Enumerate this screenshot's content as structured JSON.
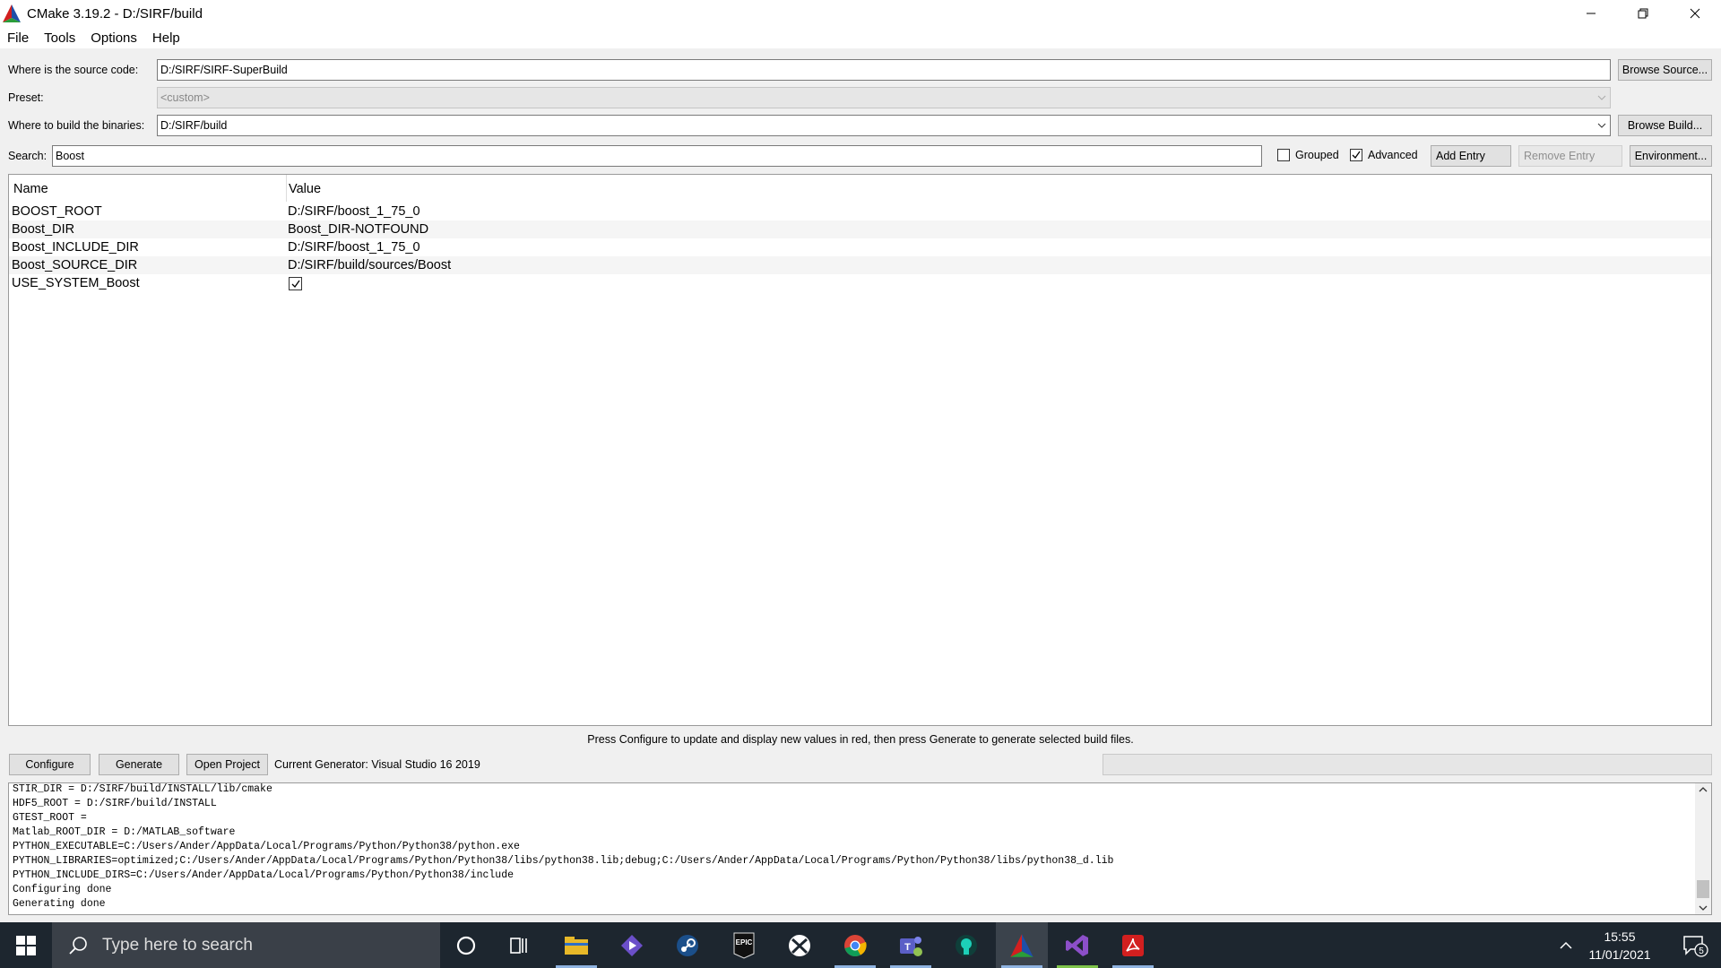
{
  "window": {
    "title": "CMake 3.19.2 - D:/SIRF/build"
  },
  "menu": [
    "File",
    "Tools",
    "Options",
    "Help"
  ],
  "source": {
    "label": "Where is the source code:",
    "value": "D:/SIRF/SIRF-SuperBuild",
    "browse": "Browse Source..."
  },
  "preset": {
    "label": "Preset:",
    "value": "<custom>"
  },
  "build": {
    "label": "Where to build the binaries:",
    "value": "D:/SIRF/build",
    "browse": "Browse Build..."
  },
  "search": {
    "label": "Search:",
    "value": "Boost"
  },
  "options": {
    "grouped": {
      "label": "Grouped",
      "checked": false
    },
    "advanced": {
      "label": "Advanced",
      "checked": true
    }
  },
  "buttons": {
    "add_entry": "Add Entry",
    "remove_entry": "Remove Entry",
    "environment": "Environment..."
  },
  "table": {
    "columns": [
      "Name",
      "Value"
    ],
    "rows": [
      {
        "name": "BOOST_ROOT",
        "value": "D:/SIRF/boost_1_75_0"
      },
      {
        "name": "Boost_DIR",
        "value": "Boost_DIR-NOTFOUND"
      },
      {
        "name": "Boost_INCLUDE_DIR",
        "value": "D:/SIRF/boost_1_75_0"
      },
      {
        "name": "Boost_SOURCE_DIR",
        "value": "D:/SIRF/build/sources/Boost"
      },
      {
        "name": "USE_SYSTEM_Boost",
        "value": "",
        "checked": true
      }
    ]
  },
  "hint": "Press Configure to update and display new values in red, then press Generate to generate selected build files.",
  "actions": {
    "configure": "Configure",
    "generate": "Generate",
    "open_project": "Open Project"
  },
  "generator": "Current Generator: Visual Studio 16 2019",
  "output": [
    "STIR_DIR = D:/SIRF/build/INSTALL/lib/cmake",
    "HDF5_ROOT = D:/SIRF/build/INSTALL",
    "GTEST_ROOT =",
    "Matlab_ROOT_DIR = D:/MATLAB_software",
    "PYTHON_EXECUTABLE=C:/Users/Ander/AppData/Local/Programs/Python/Python38/python.exe",
    "PYTHON_LIBRARIES=optimized;C:/Users/Ander/AppData/Local/Programs/Python/Python38/libs/python38.lib;debug;C:/Users/Ander/AppData/Local/Programs/Python/Python38/libs/python38_d.lib",
    "PYTHON_INCLUDE_DIRS=C:/Users/Ander/AppData/Local/Programs/Python/Python38/include",
    "Configuring done",
    "Generating done"
  ],
  "taskbar": {
    "search_placeholder": "Type here to search",
    "apps": [
      "cortana-icon",
      "task-view-icon",
      "file-explorer-icon",
      "app-purple-icon",
      "steam-icon",
      "epic-games-icon",
      "xbox-icon",
      "chrome-icon",
      "teams-icon",
      "gitkraken-icon",
      "cmake-icon",
      "visual-studio-icon",
      "acrobat-icon"
    ],
    "epic_text": "EPIC",
    "time": "15:55",
    "date": "11/01/2021",
    "notifications": "5"
  },
  "colors": {
    "taskbar": "#1d262f",
    "window_bg": "#f0f0f0",
    "cmake_red": "#d21f1f",
    "cmake_blue": "#1f4fa8",
    "vs_purple": "#8c4fc9"
  }
}
